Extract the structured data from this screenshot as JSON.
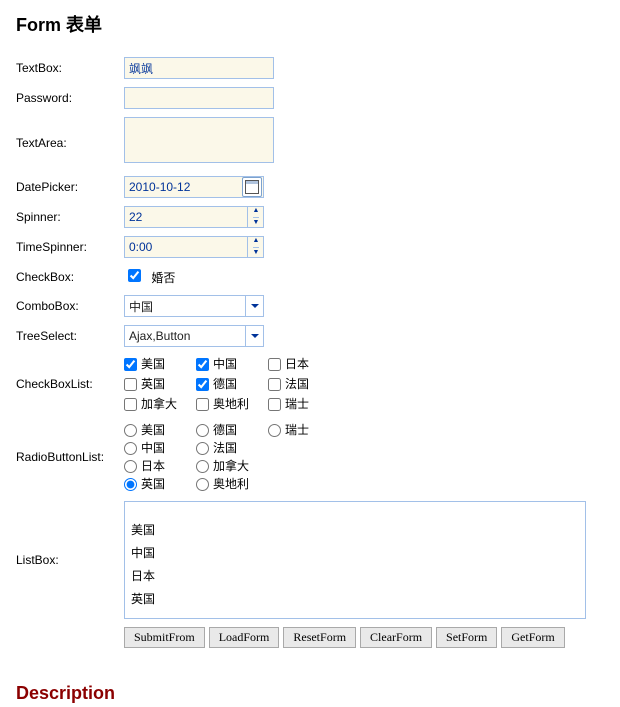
{
  "title": "Form 表单",
  "labels": {
    "textBox": "TextBox:",
    "password": "Password:",
    "textArea": "TextArea:",
    "datePicker": "DatePicker:",
    "spinner": "Spinner:",
    "timeSpinner": "TimeSpinner:",
    "checkBox": "CheckBox:",
    "comboBox": "ComboBox:",
    "treeSelect": "TreeSelect:",
    "checkBoxList": "CheckBoxList:",
    "radioButtonList": "RadioButtonList:",
    "listBox": "ListBox:"
  },
  "values": {
    "textBox": "飒飒",
    "password": "",
    "textArea": "",
    "datePicker": "2010-10-12",
    "spinner": "22",
    "timeSpinner": "0:00",
    "checkBoxLabel": "婚否",
    "checkBoxChecked": true,
    "comboBox": "中国",
    "treeSelect": "Ajax,Button"
  },
  "checkBoxList": [
    {
      "label": "美国",
      "checked": true
    },
    {
      "label": "中国",
      "checked": true
    },
    {
      "label": "日本",
      "checked": false
    },
    {
      "label": "英国",
      "checked": false
    },
    {
      "label": "德国",
      "checked": true
    },
    {
      "label": "法国",
      "checked": false
    },
    {
      "label": "加拿大",
      "checked": false
    },
    {
      "label": "奥地利",
      "checked": false
    },
    {
      "label": "瑞士",
      "checked": false
    }
  ],
  "radioButtonList": [
    {
      "label": "美国",
      "checked": false
    },
    {
      "label": "德国",
      "checked": false
    },
    {
      "label": "瑞士",
      "checked": false
    },
    {
      "label": "中国",
      "checked": false
    },
    {
      "label": "法国",
      "checked": false
    },
    {
      "label": "日本",
      "checked": false
    },
    {
      "label": "加拿大",
      "checked": false
    },
    {
      "label": "英国",
      "checked": true
    },
    {
      "label": "奥地利",
      "checked": false
    }
  ],
  "radioLayout": [
    [
      0,
      1,
      2
    ],
    [
      3,
      4
    ],
    [
      5,
      6
    ],
    [
      7,
      8
    ]
  ],
  "listBox": [
    "美国",
    "中国",
    "日本",
    "英国"
  ],
  "buttons": [
    "SubmitFrom",
    "LoadForm",
    "ResetForm",
    "ClearForm",
    "SetForm",
    "GetForm"
  ],
  "footer": "Description"
}
